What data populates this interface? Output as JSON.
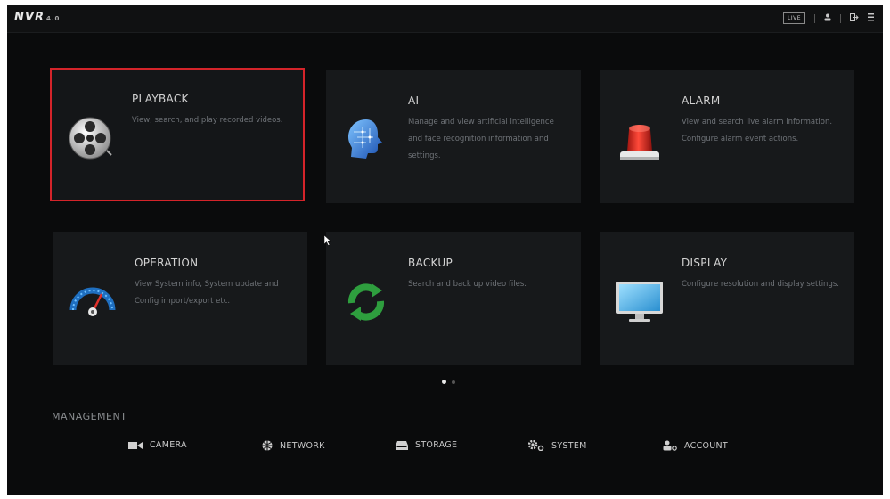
{
  "topbar": {
    "logo": "NVR",
    "logo_suffix": "4.0",
    "live_label": "LIVE",
    "icons": [
      "user-icon",
      "logout-icon",
      "menu-icon"
    ]
  },
  "tiles": [
    {
      "title": "PLAYBACK",
      "description": "View, search, and play recorded videos.",
      "icon": "film-reel-icon",
      "selected": true
    },
    {
      "title": "AI",
      "description": "Manage and view artificial intelligence and face recognition information and settings.",
      "icon": "ai-head-icon",
      "selected": false
    },
    {
      "title": "ALARM",
      "description": "View and search live alarm information. Configure alarm event actions.",
      "icon": "alarm-light-icon",
      "selected": false
    },
    {
      "title": "OPERATION",
      "description": "View System info, System update and Config import/export etc.",
      "icon": "gauge-icon",
      "selected": false
    },
    {
      "title": "BACKUP",
      "description": "Search and back up video files.",
      "icon": "backup-refresh-icon",
      "selected": false
    },
    {
      "title": "DISPLAY",
      "description": "Configure resolution and display settings.",
      "icon": "monitor-icon",
      "selected": false
    }
  ],
  "pagination": {
    "pages": 2,
    "current": 1
  },
  "management": {
    "label": "MANAGEMENT",
    "items": [
      {
        "label": "CAMERA",
        "icon": "camera-icon"
      },
      {
        "label": "NETWORK",
        "icon": "network-icon"
      },
      {
        "label": "STORAGE",
        "icon": "storage-icon"
      },
      {
        "label": "SYSTEM",
        "icon": "system-gears-icon"
      },
      {
        "label": "ACCOUNT",
        "icon": "account-icon"
      }
    ]
  },
  "colors": {
    "background": "#0a0b0c",
    "tile": "#17191b",
    "selected_border": "#d4242a",
    "backup_green": "#2e9e3e",
    "alarm_red": "#d0261c"
  }
}
